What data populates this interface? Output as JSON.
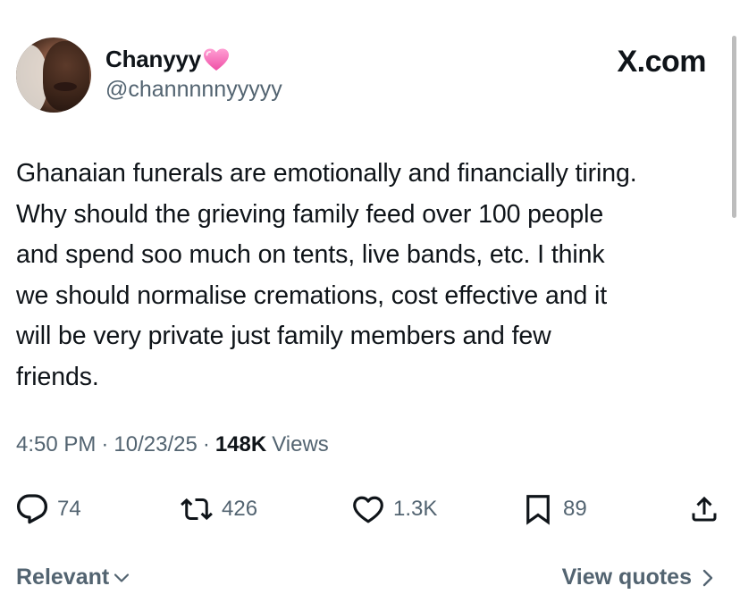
{
  "author": {
    "display_name": "Chanyyy",
    "handle": "@channnnnyyyyy",
    "badge_icon": "pink-heart-icon"
  },
  "brand": "X.com",
  "tweet": {
    "lines": [
      "Ghanaian funerals are emotionally and financially tiring.",
      "Why should the grieving family feed over 100 people",
      "and spend soo much on tents, live bands, etc. I think",
      "we should normalise cremations, cost effective and it",
      "will be very private just family members and few",
      "friends."
    ]
  },
  "meta": {
    "time": "4:50 PM",
    "separator": "·",
    "date": "10/23/25",
    "views_count": "148K",
    "views_label": "Views"
  },
  "actions": {
    "replies": "74",
    "reposts": "426",
    "likes": "1.3K",
    "bookmarks": "89"
  },
  "footer": {
    "sort_label": "Relevant",
    "view_quotes_label": "View quotes"
  },
  "colors": {
    "text": "#0f1419",
    "secondary": "#536471",
    "heart": "#f56fb5"
  }
}
